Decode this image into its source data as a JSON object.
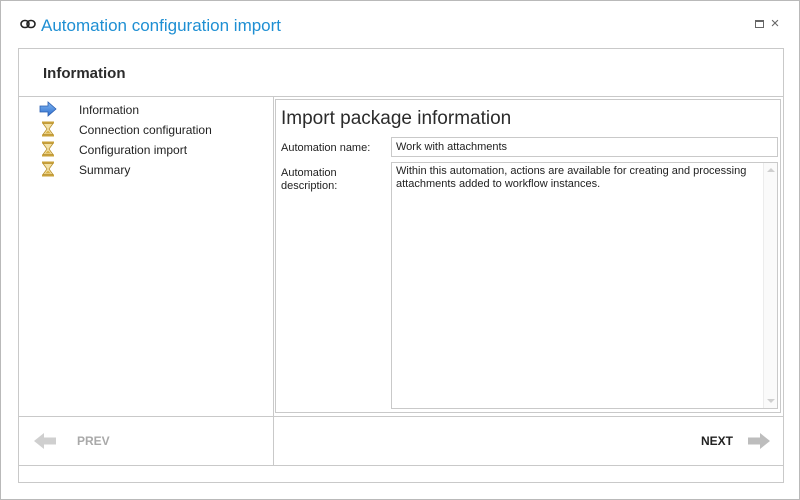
{
  "window": {
    "title": "Automation configuration import",
    "accent_color": "#1e8fd3",
    "controls": [
      "maximize-icon",
      "close-icon"
    ],
    "close_glyph": "×"
  },
  "header": {
    "title": "Information"
  },
  "steps": [
    {
      "label": "Information",
      "icon": "arrow-right-icon",
      "state": "current"
    },
    {
      "label": "Connection configuration",
      "icon": "hourglass-icon",
      "state": "pending"
    },
    {
      "label": "Configuration import",
      "icon": "hourglass-icon",
      "state": "pending"
    },
    {
      "label": "Summary",
      "icon": "hourglass-icon",
      "state": "pending"
    }
  ],
  "content": {
    "title": "Import package information",
    "name_label": "Automation name:",
    "name_value": "Work with attachments",
    "description_label": "Automation description:",
    "description_value": "Within this automation, actions are available for creating and processing attachments added to workflow instances."
  },
  "nav": {
    "prev_label": "PREV",
    "prev_enabled": false,
    "next_label": "NEXT",
    "next_enabled": true
  }
}
